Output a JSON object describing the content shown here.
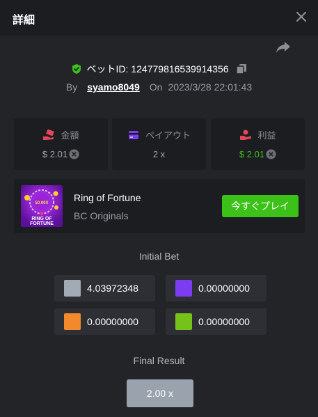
{
  "header": {
    "title": "詳細"
  },
  "bet": {
    "id_label": "ベットID:",
    "id_value": "124779816539914356",
    "by_label": "By",
    "username": "syamo8049",
    "on_label": "On",
    "datetime": "2023/3/28 22:01:43"
  },
  "stats": [
    {
      "label": "金額",
      "value": "$ 2.01"
    },
    {
      "label": "ペイアウト",
      "value": "2 x"
    },
    {
      "label": "利益",
      "value": "$ 2.01"
    }
  ],
  "game": {
    "name": "Ring of Fortune",
    "provider": "BC Originals",
    "play_label": "今すぐプレイ",
    "thumb_multiplier": "50.00X",
    "thumb_title_1": "RING OF",
    "thumb_title_2": "FORTUNE"
  },
  "initial_bet": {
    "title": "Initial Bet",
    "cells": [
      {
        "color": "#a2aab4",
        "amount": "4.03972348"
      },
      {
        "color": "#7c3cf2",
        "amount": "0.00000000"
      },
      {
        "color": "#f28a2c",
        "amount": "0.00000000"
      },
      {
        "color": "#74c21a",
        "amount": "0.00000000"
      }
    ]
  },
  "final_result": {
    "title": "Final Result",
    "value": "2.00 x"
  },
  "colors": {
    "accent_green": "#3bc117",
    "panel": "#1c1d21",
    "background": "#232428"
  }
}
